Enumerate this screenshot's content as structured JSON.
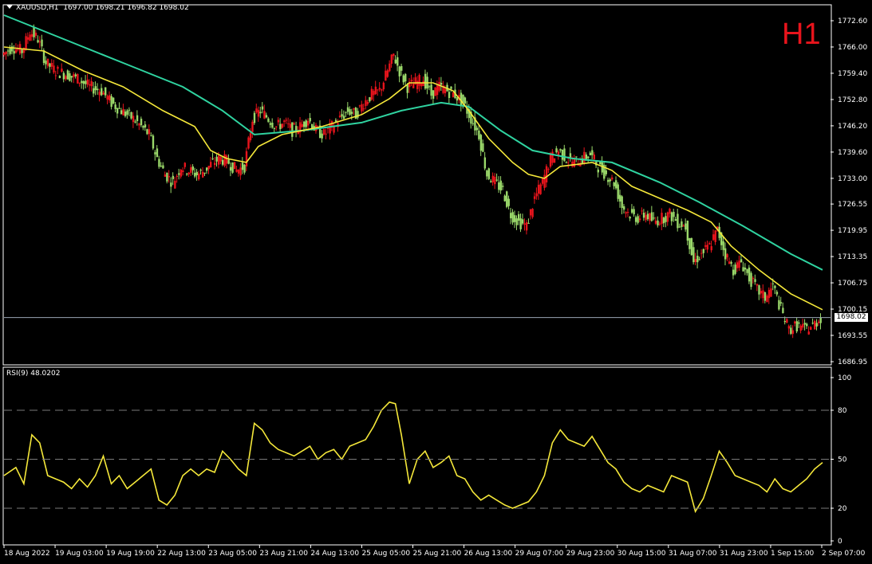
{
  "header": {
    "symbol": "XAUUSD,H1",
    "ohlc": "1697.00 1698.21 1696.82 1698.02"
  },
  "timeframe_label": "H1",
  "current_price": "1698.02",
  "rsi_header": "RSI(9) 48.0202",
  "colors": {
    "bull": "#e8141c",
    "bear": "#9ad86a",
    "ma_fast": "#f5e83a",
    "ma_slow": "#2fd3a0",
    "rsi": "#f5e83a",
    "grid": "#7a7a7a",
    "axis": "#ffffff",
    "background": "#000000"
  },
  "chart_data": [
    {
      "type": "candlestick",
      "ylim": [
        1686.95,
        1776.0
      ],
      "y_ticks": [
        "1772.60",
        "1766.00",
        "1759.40",
        "1752.80",
        "1746.20",
        "1739.60",
        "1733.00",
        "1726.55",
        "1719.95",
        "1713.35",
        "1706.75",
        "1700.15",
        "1693.55",
        "1686.95"
      ],
      "x_ticks": [
        "18 Aug 2022",
        "19 Aug 03:00",
        "19 Aug 19:00",
        "22 Aug 13:00",
        "23 Aug 05:00",
        "23 Aug 21:00",
        "24 Aug 13:00",
        "25 Aug 05:00",
        "25 Aug 21:00",
        "26 Aug 13:00",
        "29 Aug 07:00",
        "29 Aug 23:00",
        "30 Aug 15:00",
        "31 Aug 07:00",
        "31 Aug 23:00",
        "1 Sep 15:00",
        "2 Sep 07:00"
      ],
      "close_path": [
        [
          0,
          1764
        ],
        [
          5,
          1766
        ],
        [
          10,
          1765
        ],
        [
          14,
          1770
        ],
        [
          18,
          1768
        ],
        [
          22,
          1762
        ],
        [
          27,
          1760
        ],
        [
          33,
          1759
        ],
        [
          38,
          1758
        ],
        [
          44,
          1756
        ],
        [
          50,
          1755
        ],
        [
          55,
          1752
        ],
        [
          60,
          1750
        ],
        [
          66,
          1748
        ],
        [
          70,
          1746
        ],
        [
          74,
          1744
        ],
        [
          78,
          1738
        ],
        [
          82,
          1734
        ],
        [
          86,
          1732
        ],
        [
          90,
          1736
        ],
        [
          94,
          1735
        ],
        [
          98,
          1734
        ],
        [
          102,
          1735
        ],
        [
          106,
          1737
        ],
        [
          110,
          1738
        ],
        [
          114,
          1737
        ],
        [
          118,
          1735
        ],
        [
          122,
          1736
        ],
        [
          126,
          1748
        ],
        [
          130,
          1750
        ],
        [
          134,
          1748
        ],
        [
          138,
          1746
        ],
        [
          142,
          1747
        ],
        [
          146,
          1745
        ],
        [
          150,
          1746
        ],
        [
          154,
          1748
        ],
        [
          158,
          1745
        ],
        [
          162,
          1744
        ],
        [
          166,
          1746
        ],
        [
          170,
          1748
        ],
        [
          174,
          1750
        ],
        [
          178,
          1749
        ],
        [
          182,
          1752
        ],
        [
          186,
          1754
        ],
        [
          190,
          1755
        ],
        [
          194,
          1760
        ],
        [
          197,
          1764
        ],
        [
          200,
          1760
        ],
        [
          204,
          1756
        ],
        [
          208,
          1757
        ],
        [
          212,
          1758
        ],
        [
          216,
          1754
        ],
        [
          220,
          1756
        ],
        [
          224,
          1755
        ],
        [
          228,
          1754
        ],
        [
          232,
          1752
        ],
        [
          236,
          1748
        ],
        [
          240,
          1744
        ],
        [
          244,
          1734
        ],
        [
          248,
          1732
        ],
        [
          252,
          1730
        ],
        [
          256,
          1724
        ],
        [
          260,
          1722
        ],
        [
          264,
          1721
        ],
        [
          268,
          1728
        ],
        [
          272,
          1732
        ],
        [
          276,
          1738
        ],
        [
          280,
          1740
        ],
        [
          284,
          1738
        ],
        [
          288,
          1737
        ],
        [
          292,
          1738
        ],
        [
          296,
          1739
        ],
        [
          300,
          1736
        ],
        [
          304,
          1734
        ],
        [
          308,
          1732
        ],
        [
          312,
          1726
        ],
        [
          316,
          1724
        ],
        [
          320,
          1723
        ],
        [
          324,
          1724
        ],
        [
          328,
          1722
        ],
        [
          332,
          1723
        ],
        [
          336,
          1724
        ],
        [
          340,
          1722
        ],
        [
          344,
          1721
        ],
        [
          348,
          1712
        ],
        [
          352,
          1714
        ],
        [
          356,
          1716
        ],
        [
          360,
          1720
        ],
        [
          364,
          1714
        ],
        [
          368,
          1710
        ],
        [
          372,
          1712
        ],
        [
          376,
          1708
        ],
        [
          380,
          1705
        ],
        [
          384,
          1703
        ],
        [
          388,
          1706
        ],
        [
          392,
          1700
        ],
        [
          396,
          1695
        ],
        [
          400,
          1696
        ],
        [
          404,
          1695
        ],
        [
          408,
          1696
        ],
        [
          412,
          1698
        ]
      ],
      "ma_fast": [
        [
          0,
          1766
        ],
        [
          20,
          1765
        ],
        [
          40,
          1760
        ],
        [
          60,
          1756
        ],
        [
          80,
          1750
        ],
        [
          96,
          1746
        ],
        [
          104,
          1740
        ],
        [
          112,
          1738
        ],
        [
          122,
          1737
        ],
        [
          128,
          1741
        ],
        [
          140,
          1744
        ],
        [
          160,
          1746
        ],
        [
          180,
          1749
        ],
        [
          194,
          1753
        ],
        [
          204,
          1757
        ],
        [
          216,
          1757
        ],
        [
          226,
          1755
        ],
        [
          234,
          1750
        ],
        [
          244,
          1743
        ],
        [
          256,
          1737
        ],
        [
          264,
          1734
        ],
        [
          272,
          1733
        ],
        [
          280,
          1736
        ],
        [
          296,
          1737
        ],
        [
          306,
          1735
        ],
        [
          316,
          1731
        ],
        [
          330,
          1728
        ],
        [
          344,
          1725
        ],
        [
          356,
          1722
        ],
        [
          366,
          1716
        ],
        [
          380,
          1710
        ],
        [
          396,
          1704
        ],
        [
          412,
          1700
        ]
      ],
      "ma_slow": [
        [
          0,
          1774
        ],
        [
          30,
          1768
        ],
        [
          60,
          1762
        ],
        [
          90,
          1756
        ],
        [
          110,
          1750
        ],
        [
          126,
          1744
        ],
        [
          150,
          1745
        ],
        [
          180,
          1747
        ],
        [
          200,
          1750
        ],
        [
          220,
          1752
        ],
        [
          234,
          1751
        ],
        [
          250,
          1745
        ],
        [
          266,
          1740
        ],
        [
          286,
          1738
        ],
        [
          306,
          1737
        ],
        [
          330,
          1732
        ],
        [
          350,
          1727
        ],
        [
          372,
          1721
        ],
        [
          396,
          1714
        ],
        [
          412,
          1710
        ]
      ]
    },
    {
      "type": "line",
      "name": "RSI(9)",
      "ylim": [
        0,
        100
      ],
      "levels": [
        20,
        50,
        80
      ],
      "y_ticks": [
        "100",
        "80",
        "50",
        "20",
        "0"
      ],
      "values": [
        [
          0,
          40
        ],
        [
          6,
          45
        ],
        [
          10,
          35
        ],
        [
          14,
          65
        ],
        [
          18,
          60
        ],
        [
          22,
          40
        ],
        [
          26,
          38
        ],
        [
          30,
          36
        ],
        [
          34,
          32
        ],
        [
          38,
          38
        ],
        [
          42,
          33
        ],
        [
          46,
          40
        ],
        [
          50,
          52
        ],
        [
          54,
          35
        ],
        [
          58,
          40
        ],
        [
          62,
          32
        ],
        [
          66,
          36
        ],
        [
          70,
          40
        ],
        [
          74,
          44
        ],
        [
          78,
          25
        ],
        [
          82,
          22
        ],
        [
          86,
          28
        ],
        [
          90,
          40
        ],
        [
          94,
          44
        ],
        [
          98,
          40
        ],
        [
          102,
          44
        ],
        [
          106,
          42
        ],
        [
          110,
          55
        ],
        [
          114,
          50
        ],
        [
          118,
          44
        ],
        [
          122,
          40
        ],
        [
          126,
          72
        ],
        [
          130,
          68
        ],
        [
          134,
          60
        ],
        [
          138,
          56
        ],
        [
          142,
          54
        ],
        [
          146,
          52
        ],
        [
          150,
          55
        ],
        [
          154,
          58
        ],
        [
          158,
          50
        ],
        [
          162,
          54
        ],
        [
          166,
          56
        ],
        [
          170,
          50
        ],
        [
          174,
          58
        ],
        [
          178,
          60
        ],
        [
          182,
          62
        ],
        [
          186,
          70
        ],
        [
          190,
          80
        ],
        [
          194,
          85
        ],
        [
          197,
          84
        ],
        [
          200,
          65
        ],
        [
          204,
          35
        ],
        [
          208,
          50
        ],
        [
          212,
          55
        ],
        [
          216,
          45
        ],
        [
          220,
          48
        ],
        [
          224,
          52
        ],
        [
          228,
          40
        ],
        [
          232,
          38
        ],
        [
          236,
          30
        ],
        [
          240,
          25
        ],
        [
          244,
          28
        ],
        [
          248,
          25
        ],
        [
          252,
          22
        ],
        [
          256,
          20
        ],
        [
          260,
          22
        ],
        [
          264,
          24
        ],
        [
          268,
          30
        ],
        [
          272,
          40
        ],
        [
          276,
          60
        ],
        [
          280,
          68
        ],
        [
          284,
          62
        ],
        [
          288,
          60
        ],
        [
          292,
          58
        ],
        [
          296,
          64
        ],
        [
          300,
          56
        ],
        [
          304,
          48
        ],
        [
          308,
          44
        ],
        [
          312,
          36
        ],
        [
          316,
          32
        ],
        [
          320,
          30
        ],
        [
          324,
          34
        ],
        [
          328,
          32
        ],
        [
          332,
          30
        ],
        [
          336,
          40
        ],
        [
          340,
          38
        ],
        [
          344,
          36
        ],
        [
          348,
          18
        ],
        [
          352,
          26
        ],
        [
          356,
          40
        ],
        [
          360,
          55
        ],
        [
          364,
          48
        ],
        [
          368,
          40
        ],
        [
          372,
          38
        ],
        [
          376,
          36
        ],
        [
          380,
          34
        ],
        [
          384,
          30
        ],
        [
          388,
          38
        ],
        [
          392,
          32
        ],
        [
          396,
          30
        ],
        [
          400,
          34
        ],
        [
          404,
          38
        ],
        [
          408,
          44
        ],
        [
          412,
          48
        ]
      ]
    }
  ]
}
